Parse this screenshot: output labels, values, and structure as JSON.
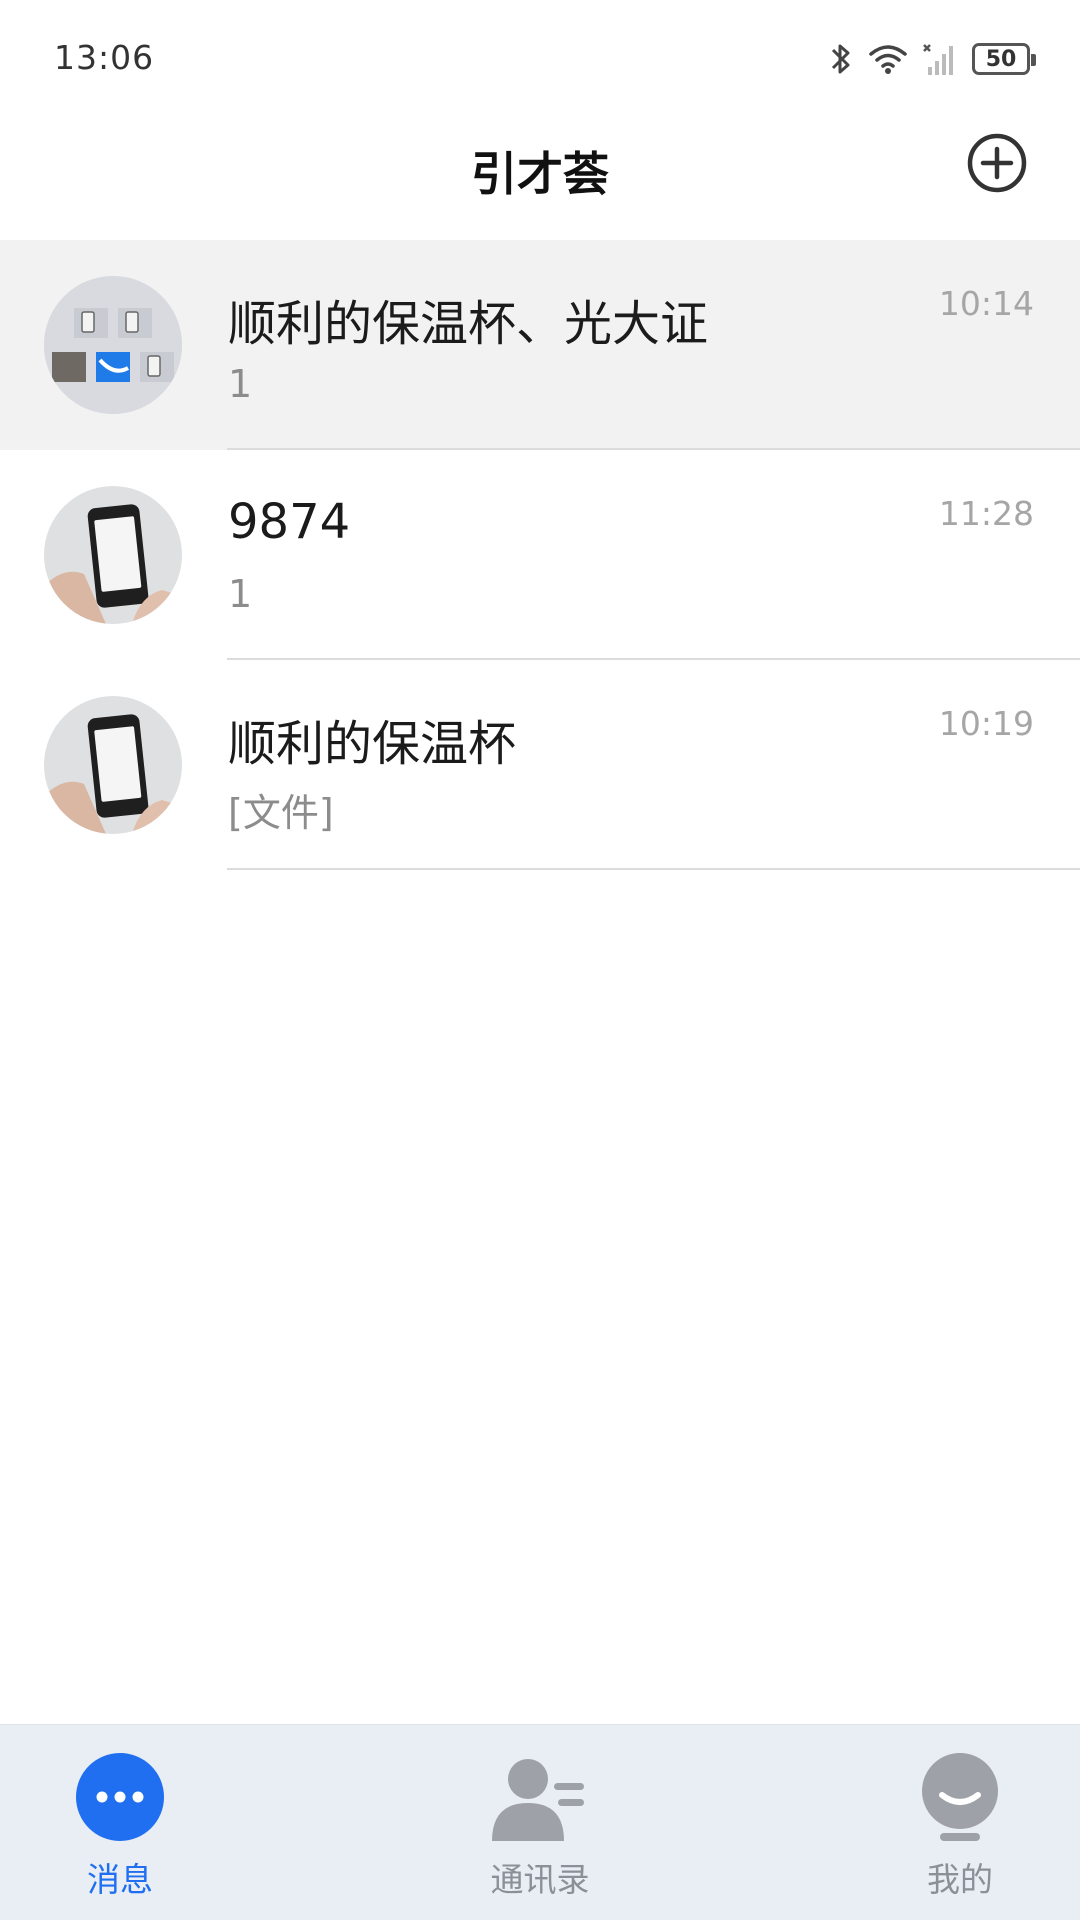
{
  "status_bar": {
    "time": "13:06",
    "battery": "50",
    "icons": [
      "bluetooth-icon",
      "wifi-icon",
      "signal-icon",
      "battery-icon"
    ]
  },
  "header": {
    "title": "引才荟",
    "add_icon": "plus-circle-icon"
  },
  "conversations": [
    {
      "name": "顺利的保温杯、光大证",
      "preview": "1",
      "time": "10:14",
      "avatar": "group-avatar"
    },
    {
      "name": "9874",
      "preview": "1",
      "time": "11:28",
      "avatar": "phone-photo-avatar"
    },
    {
      "name": "顺利的保温杯",
      "preview": "[文件]",
      "time": "10:19",
      "avatar": "phone-photo-avatar"
    }
  ],
  "tabs": [
    {
      "label": "消息",
      "icon": "chat-bubble-icon",
      "active": true
    },
    {
      "label": "通讯录",
      "icon": "contacts-icon",
      "active": false
    },
    {
      "label": "我的",
      "icon": "profile-icon",
      "active": false
    }
  ],
  "colors": {
    "accent": "#1f6ff0",
    "tab_bar_bg": "#e9edf4",
    "active_row_bg": "#f2f2f3"
  }
}
